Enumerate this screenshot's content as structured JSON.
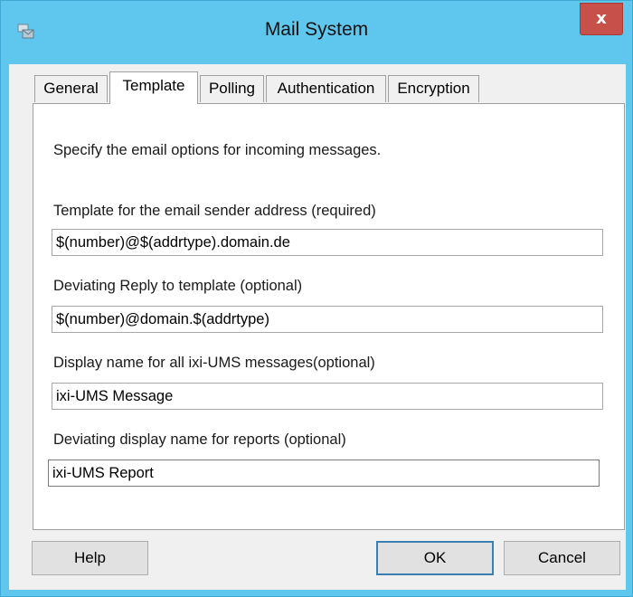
{
  "window": {
    "title": "Mail System",
    "close_label": "x"
  },
  "tabs": [
    {
      "label": "General",
      "active": false
    },
    {
      "label": "Template",
      "active": true
    },
    {
      "label": "Polling",
      "active": false
    },
    {
      "label": "Authentication",
      "active": false
    },
    {
      "label": "Encryption",
      "active": false
    }
  ],
  "panel": {
    "description": "Specify the email options for incoming messages.",
    "fields": [
      {
        "label": "Template for the email sender address (required)",
        "value": "$(number)@$(addrtype).domain.de"
      },
      {
        "label": "Deviating Reply to template (optional)",
        "value": "$(number)@domain.$(addrtype)"
      },
      {
        "label": "Display name for all ixi-UMS messages(optional)",
        "value": "ixi-UMS Message"
      },
      {
        "label": "Deviating display name for reports (optional)",
        "value": "ixi-UMS Report"
      }
    ]
  },
  "buttons": {
    "help": "Help",
    "ok": "OK",
    "cancel": "Cancel"
  },
  "colors": {
    "titlebar": "#5fc7ee",
    "close": "#c7514a",
    "client": "#f0f0f0"
  }
}
